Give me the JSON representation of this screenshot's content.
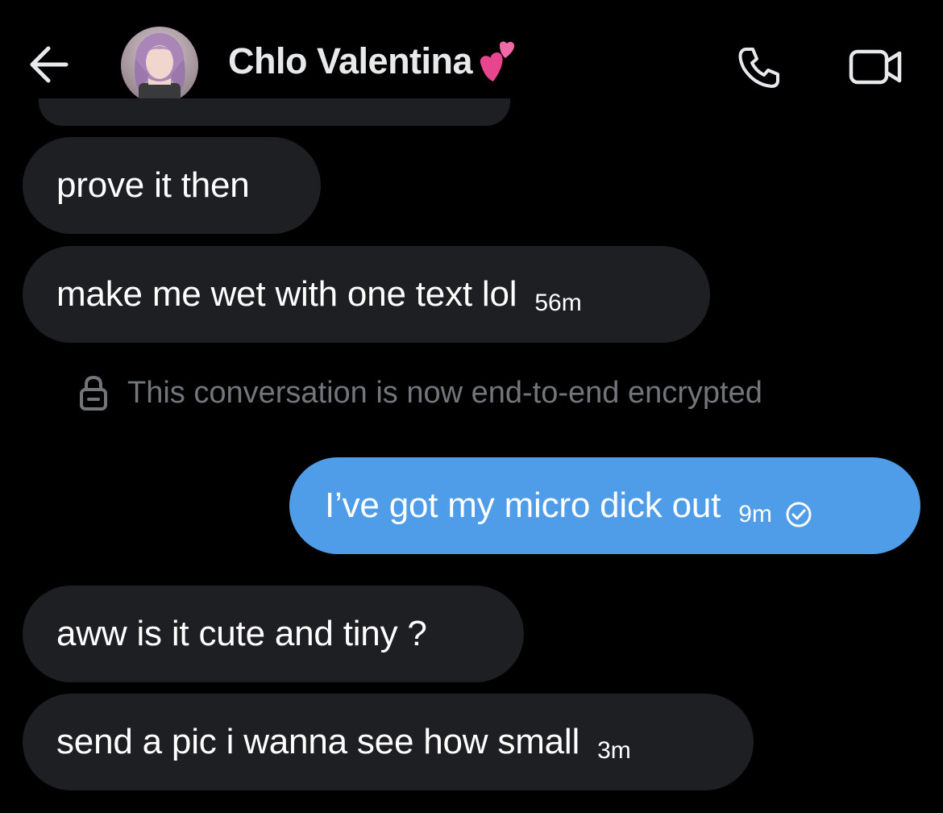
{
  "header": {
    "contact_name": "Chlo Valentina",
    "icons": {
      "back": "arrow-left-icon",
      "call": "phone-icon",
      "video": "video-camera-icon",
      "name_emoji": "two-hearts-emoji"
    }
  },
  "messages": [
    {
      "direction": "received",
      "text": "prove it then",
      "time": ""
    },
    {
      "direction": "received",
      "text": "make me wet with one text lol",
      "time": "56m"
    },
    {
      "direction": "sent",
      "text": "I’ve got my micro dick out",
      "time": "9m",
      "status_icon": "check-circle-icon"
    },
    {
      "direction": "received",
      "text": "aww is it cute and tiny ?",
      "time": ""
    },
    {
      "direction": "received",
      "text": "send a pic i wanna see how small",
      "time": "3m"
    }
  ],
  "encryption_notice": {
    "text": "This conversation is now end-to-end encrypted",
    "icon": "lock-icon"
  },
  "colors": {
    "background": "#000000",
    "received_bubble": "#1d1f23",
    "sent_bubble": "#4f9ce8",
    "secondary_text": "#72767b",
    "primary_text": "#e7e9ea"
  }
}
